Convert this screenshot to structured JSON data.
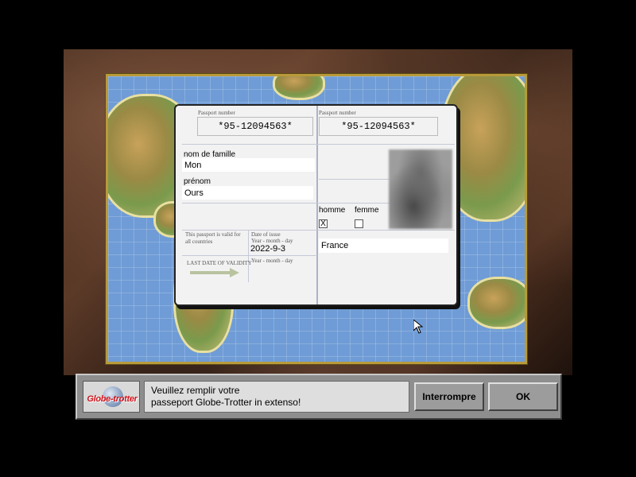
{
  "passport": {
    "number_label_left": "Passport number",
    "number_label_right": "Passport number",
    "number_left": "*95-12094563*",
    "number_right": "*95-12094563*",
    "surname_label": "nom de famille",
    "surname_value": "Mon",
    "firstname_label": "prénom",
    "firstname_value": "Ours",
    "validity_text": "This passport is valid for all countries",
    "date_issue_label": "Date of issue",
    "date_format_1": "Year - month - day",
    "date_issue_value": "2022-9-3",
    "last_date_label": "LAST DATE OF VALIDITY",
    "date_format_2": "Year - month - day",
    "male_label": "homme",
    "female_label": "femme",
    "male_checked_mark": "X",
    "country_value": "France"
  },
  "panel": {
    "logo_text": "Globe-trotter",
    "message_line1": "Veuillez remplir votre",
    "message_line2": "passeport Globe-Trotter in extenso!",
    "interrupt_button": "Interrompre",
    "ok_button": "OK"
  },
  "icons": {
    "cursor": "mouse-pointer-icon",
    "arrow": "arrow-right-icon",
    "globe": "globe-icon"
  }
}
